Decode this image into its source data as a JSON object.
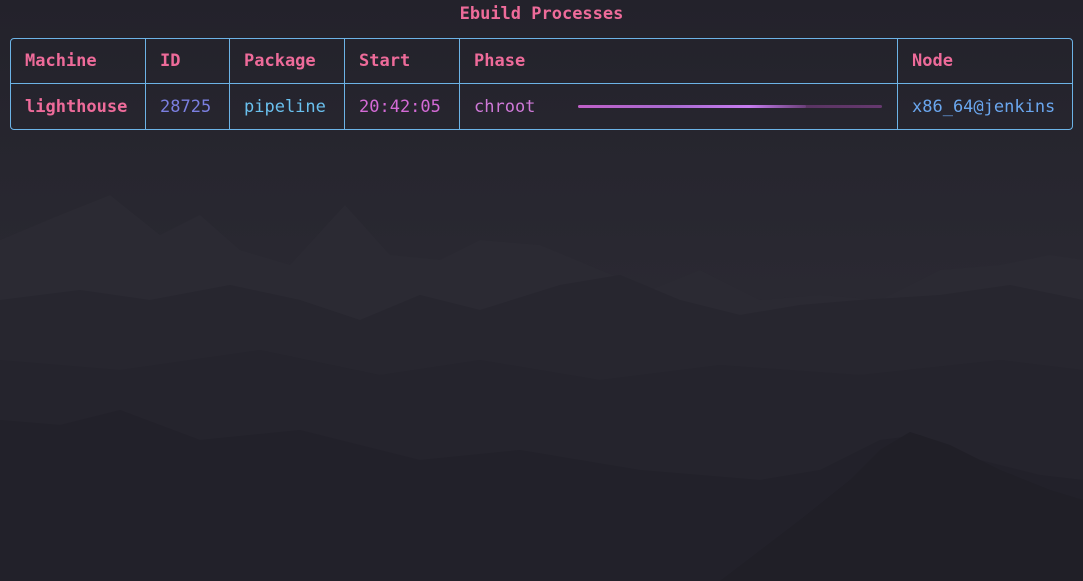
{
  "title": "Ebuild Processes",
  "columns": [
    "Machine",
    "ID",
    "Package",
    "Start",
    "Phase",
    "Node"
  ],
  "rows": [
    {
      "machine": "lighthouse",
      "id": "28725",
      "package": "pipeline",
      "start": "20:42:05",
      "phase": "chroot",
      "progress": 0.75,
      "node": "x86_64@jenkins"
    }
  ],
  "colors": {
    "accent_pink": "#ee6b9a",
    "border_blue": "#6cb3e6",
    "id_purple": "#7b7fe0",
    "package_cyan": "#6ac0ee",
    "start_magenta": "#d46ad6",
    "node_blue": "#6aa6ee",
    "background": "#24232c"
  }
}
